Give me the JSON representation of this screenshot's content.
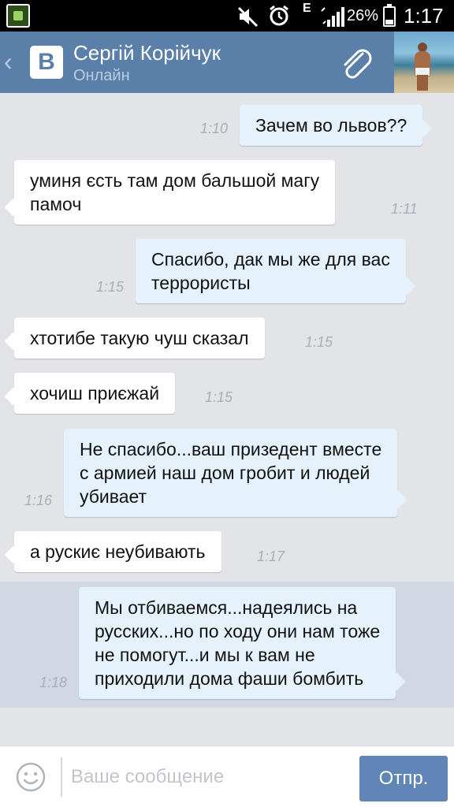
{
  "status_bar": {
    "network_type": "E",
    "battery": "26%",
    "battery_level": 0.26,
    "time": "1:17"
  },
  "header": {
    "logo_letter": "В",
    "contact_name": "Сергій Корійчук",
    "contact_status": "Онлайн",
    "back_icon": "chevron-left-icon",
    "attach_icon": "paperclip-icon"
  },
  "messages": [
    {
      "direction": "outgoing",
      "text": "Зачем во львов??",
      "time": "1:10"
    },
    {
      "direction": "incoming",
      "lines": [
        "уминя єсть там дом бальшой магу",
        "памоч"
      ],
      "time": "1:11"
    },
    {
      "direction": "outgoing",
      "lines": [
        "Спасибо, дак мы же для вас",
        "террористы"
      ],
      "time": "1:15"
    },
    {
      "direction": "incoming",
      "text": "хтотибе такую чуш сказал",
      "time": "1:15"
    },
    {
      "direction": "incoming",
      "text": "хочиш приєжай",
      "time": "1:15"
    },
    {
      "direction": "outgoing",
      "lines": [
        "Не спасибо...ваш призедент вместе",
        "с армией наш дом гробит и людей",
        "убивает"
      ],
      "time": "1:16"
    },
    {
      "direction": "incoming",
      "text": "а рускиє неубивають",
      "time": "1:17"
    },
    {
      "direction": "outgoing",
      "lines": [
        "Мы отбиваемся...надеялись на",
        "русских...но по ходу они нам тоже",
        "не помогут...и мы к вам не",
        "приходили дома фаши бомбить"
      ],
      "time": "1:18"
    }
  ],
  "input_bar": {
    "emoji_icon": "smile-icon",
    "placeholder": "Ваше сообщение",
    "value": "",
    "send_label": "Отпр."
  },
  "colors": {
    "header_bg": "#5a7fa8",
    "chat_bg": "#e3e4e8",
    "incoming_bubble": "#ffffff",
    "outgoing_bubble": "#e6f2fb",
    "send_button": "#5f86b6"
  }
}
